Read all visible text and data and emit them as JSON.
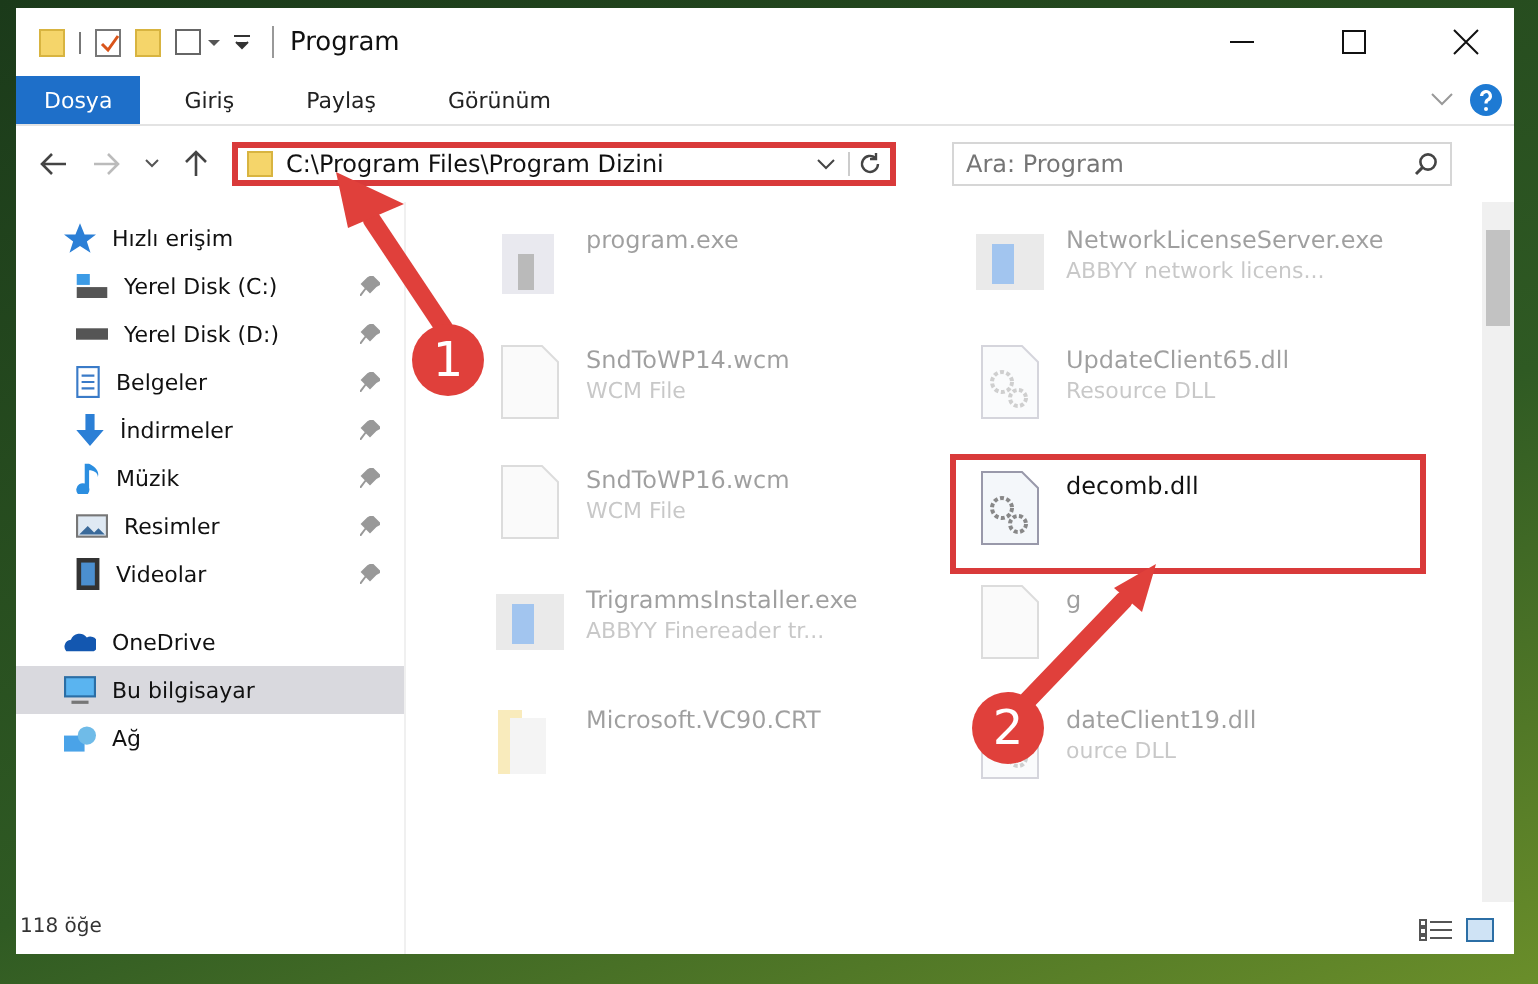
{
  "window": {
    "title": "Program"
  },
  "ribbon_tabs": [
    {
      "label": "Dosya",
      "selected": true
    },
    {
      "label": "Giriş",
      "selected": false
    },
    {
      "label": "Paylaş",
      "selected": false
    },
    {
      "label": "Görünüm",
      "selected": false
    }
  ],
  "address_bar": {
    "path": "C:\\Program Files\\Program Dizini",
    "highlighted": true
  },
  "search": {
    "placeholder": "Ara: Program"
  },
  "sidebar": {
    "items": [
      {
        "label": "Hızlı erişim",
        "selected": false,
        "children": [
          {
            "label": "Yerel Disk (C:)",
            "pinned": true,
            "selected": false
          },
          {
            "label": "Yerel Disk (D:)",
            "pinned": true,
            "selected": false
          },
          {
            "label": "Belgeler",
            "pinned": true,
            "selected": false
          },
          {
            "label": "İndirmeler",
            "pinned": true,
            "selected": false
          },
          {
            "label": "Müzik",
            "pinned": true,
            "selected": false
          },
          {
            "label": "Resimler",
            "pinned": true,
            "selected": false
          },
          {
            "label": "Videolar",
            "pinned": true,
            "selected": false
          }
        ]
      },
      {
        "label": "OneDrive",
        "selected": false
      },
      {
        "label": "Bu bilgisayar",
        "selected": true
      },
      {
        "label": "Ağ",
        "selected": false
      }
    ]
  },
  "files": [
    {
      "name": "program.exe",
      "kind": "exe",
      "faded": true,
      "highlighted": false
    },
    {
      "name": "NetworkLicenseServer.exe",
      "type": "ABBYY network licens...",
      "kind": "app",
      "faded": true,
      "highlighted": false
    },
    {
      "name": "SndToWP14.wcm",
      "type": "WCM File",
      "kind": "blank",
      "faded": true,
      "highlighted": false
    },
    {
      "name": "UpdateClient65.dll",
      "type": "Resource DLL",
      "kind": "dll",
      "faded": true,
      "highlighted": false
    },
    {
      "name": "SndToWP16.wcm",
      "type": "WCM File",
      "kind": "blank",
      "faded": true,
      "highlighted": false
    },
    {
      "name": "decomb.dll",
      "kind": "dll",
      "faded": false,
      "highlighted": true
    },
    {
      "name": "TrigrammsInstaller.exe",
      "type": "ABBYY Finereader tr...",
      "kind": "app",
      "faded": true,
      "highlighted": false
    },
    {
      "name": "g",
      "kind": "blank",
      "faded": true,
      "highlighted": false
    },
    {
      "name": "Microsoft.VC90.CRT",
      "kind": "folder",
      "faded": true,
      "highlighted": false
    },
    {
      "name": "dateClient19.dll",
      "type": "ource DLL",
      "kind": "dll",
      "faded": true,
      "highlighted": false
    }
  ],
  "status_bar": {
    "count": "118 öğe"
  },
  "callouts": [
    {
      "number": "1"
    },
    {
      "number": "2"
    }
  ]
}
